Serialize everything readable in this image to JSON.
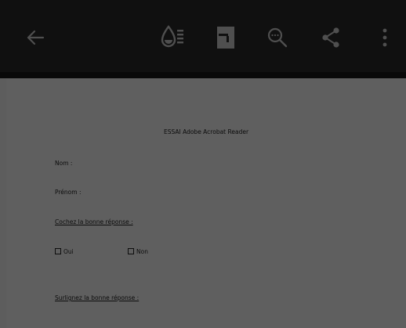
{
  "toolbar": {
    "icons": [
      "back-arrow-icon",
      "ink-icon",
      "layout-icon",
      "search-icon",
      "share-icon",
      "more-vert-icon"
    ]
  },
  "document": {
    "title": "ESSAI Adobe Acrobat Reader",
    "nom_label": "Nom :",
    "prenom_label": "Prénom :",
    "cochez_label": "Cochez la bonne réponse :",
    "oui_label": "Oui",
    "non_label": "Non",
    "surlignez_label": "Surlignez la bonne réponse :"
  },
  "colors": {
    "toolbar_bg": "#2a2a2a",
    "icon_color": "#cfcfcf",
    "dim_overlay": "rgba(0,0,0,0.62)"
  }
}
